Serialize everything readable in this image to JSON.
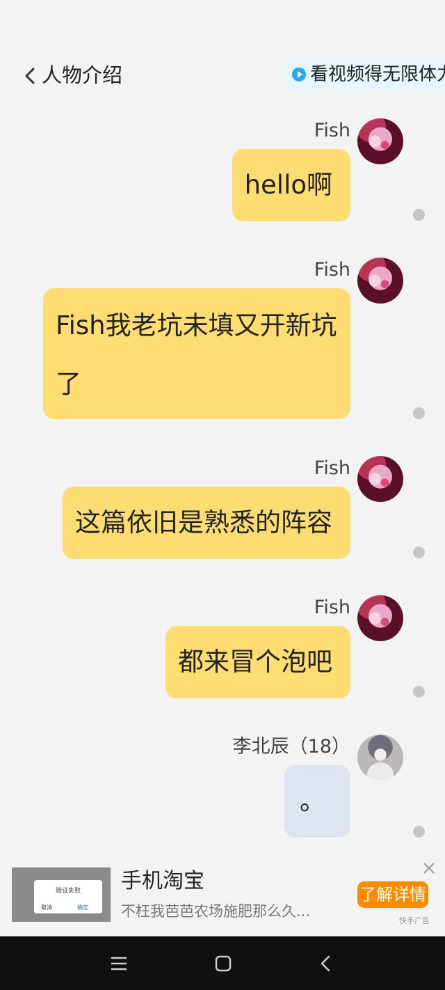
{
  "header": {
    "title": "人物介绍",
    "video_text": "看视频得无限体力"
  },
  "messages": [
    {
      "sender": "Fish",
      "text": "hello啊"
    },
    {
      "sender": "Fish",
      "text": "Fish我老坑未填又开新坑了"
    },
    {
      "sender": "Fish",
      "text": "这篇依旧是熟悉的阵容"
    },
    {
      "sender": "Fish",
      "text": "都来冒个泡吧"
    },
    {
      "sender": "李北辰（18）",
      "text": "。"
    }
  ],
  "ad": {
    "title": "手机淘宝",
    "description": "不枉我芭芭农场施肥那么久...",
    "cta": "了解详情",
    "label": "快手广告",
    "thumb_dialog_title": "验证失败",
    "thumb_cancel": "取消",
    "thumb_confirm": "确定"
  },
  "colors": {
    "bubble": "#fddd72",
    "bubble_grey": "#dfe5ee",
    "background": "#f3f3f3",
    "cta": "#ff8a00"
  },
  "icons": [
    "chevron-left-icon",
    "play-icon",
    "close-icon",
    "menu-icon",
    "home-icon",
    "back-icon"
  ]
}
